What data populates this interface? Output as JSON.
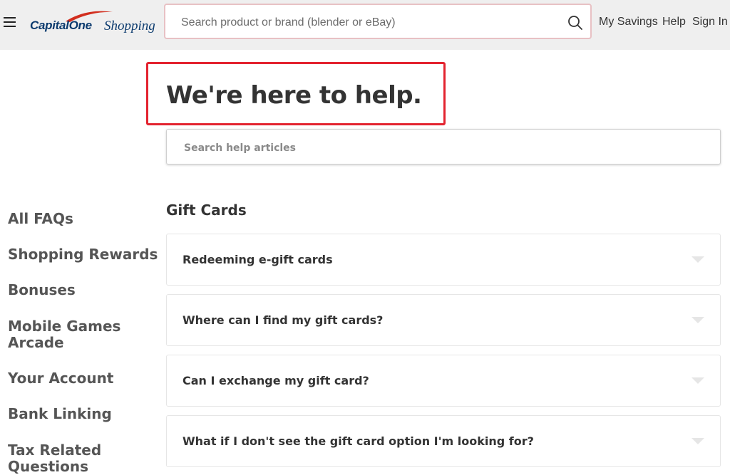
{
  "header": {
    "logo_brand": "CapitalOne",
    "logo_sub": "Shopping",
    "search_placeholder": "Search product or brand (blender or eBay)",
    "nav": {
      "my_savings": "My Savings",
      "help": "Help",
      "sign_in": "Sign In"
    }
  },
  "hero": {
    "title": "We're here to help.",
    "search_placeholder": "Search help articles"
  },
  "sidebar": {
    "items": [
      {
        "label": "All FAQs"
      },
      {
        "label": "Shopping Rewards"
      },
      {
        "label": "Bonuses"
      },
      {
        "label": "Mobile Games Arcade"
      },
      {
        "label": "Your Account"
      },
      {
        "label": "Bank Linking"
      },
      {
        "label": "Tax Related Questions"
      }
    ]
  },
  "section": {
    "title": "Gift Cards",
    "faqs": [
      {
        "question": "Redeeming e-gift cards"
      },
      {
        "question": "Where can I find my gift cards?"
      },
      {
        "question": "Can I exchange my gift card?"
      },
      {
        "question": "What if I don't see the gift card option I'm looking for?"
      }
    ]
  },
  "colors": {
    "header_bg": "#efefef",
    "highlight": "#e3232f",
    "brand_navy": "#0b3a6e",
    "brand_red": "#d22e1e"
  }
}
